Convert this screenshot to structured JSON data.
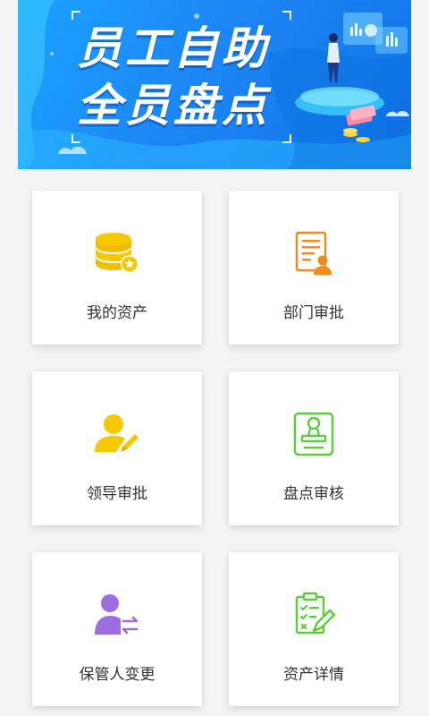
{
  "banner": {
    "title_line1": "员工自助",
    "title_line2": "全员盘点",
    "colors": {
      "primary": "#1d86f5",
      "light": "#1aa3ff"
    }
  },
  "menu": [
    {
      "label": "我的资产",
      "icon": "coins-stack-icon",
      "color": "#f5c800"
    },
    {
      "label": "部门审批",
      "icon": "document-person-icon",
      "color": "#f08c1e"
    },
    {
      "label": "领导审批",
      "icon": "person-edit-icon",
      "color": "#f5c800"
    },
    {
      "label": "盘点审核",
      "icon": "stamp-icon",
      "color": "#5ccc3a"
    },
    {
      "label": "保管人变更",
      "icon": "person-transfer-icon",
      "color": "#9b6de0"
    },
    {
      "label": "资产详情",
      "icon": "checklist-clipboard-icon",
      "color": "#5ccc3a"
    }
  ]
}
